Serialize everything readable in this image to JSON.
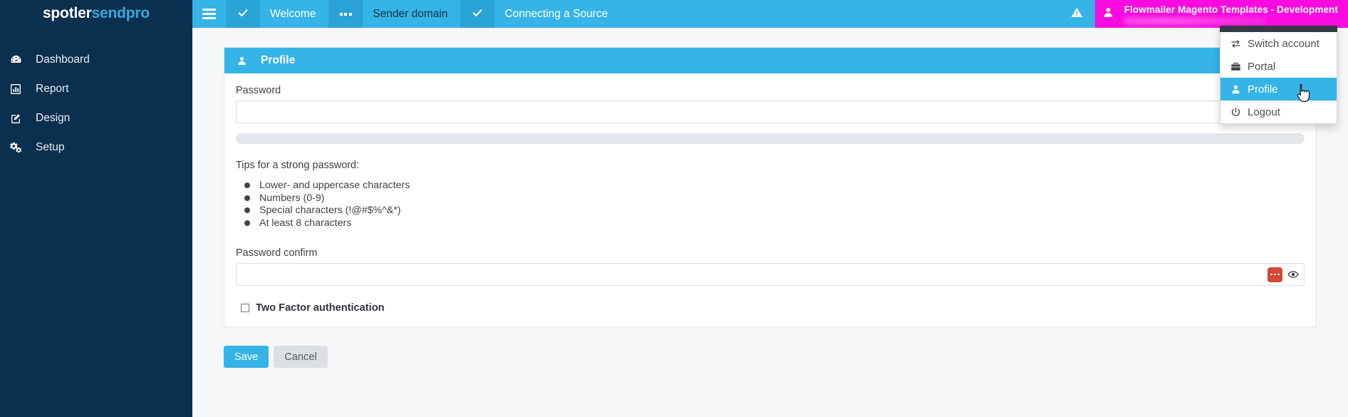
{
  "brand": {
    "part1": "spotler",
    "part2": "sendpro"
  },
  "sidebar": {
    "items": [
      {
        "label": "Dashboard",
        "icon": "dashboard-icon"
      },
      {
        "label": "Report",
        "icon": "chart-bar-icon"
      },
      {
        "label": "Design",
        "icon": "pencil-square-icon"
      },
      {
        "label": "Setup",
        "icon": "gears-icon"
      }
    ]
  },
  "topbar": {
    "menu_toggle": "hamburger-icon",
    "steps": [
      {
        "status_icon": "check-icon",
        "label": "Welcome"
      },
      {
        "status_icon": "ellipsis-icon",
        "label": "Sender domain"
      },
      {
        "status_icon": "check-icon",
        "label": "Connecting a Source"
      }
    ],
    "warning_icon": "warning-triangle-icon",
    "account": {
      "icon": "user-icon",
      "name": "Flowmailer Magento Templates - Development",
      "subtitle_redacted": ""
    }
  },
  "account_menu": {
    "items": [
      {
        "label": "Switch account",
        "icon": "exchange-icon",
        "active": false
      },
      {
        "label": "Portal",
        "icon": "briefcase-icon",
        "active": false
      },
      {
        "label": "Profile",
        "icon": "user-icon",
        "active": true
      },
      {
        "label": "Logout",
        "icon": "power-icon",
        "active": false
      }
    ]
  },
  "profile_panel": {
    "icon": "user-icon",
    "title": "Profile",
    "password": {
      "label": "Password",
      "value": "",
      "placeholder": "",
      "strength_percent": 0
    },
    "tips": {
      "title": "Tips for a strong password:",
      "items": [
        "Lower- and uppercase characters",
        "Numbers (0-9)",
        "Special characters (!@#$%^&*)",
        "At least 8 characters"
      ]
    },
    "password_confirm": {
      "label": "Password confirm",
      "value": "",
      "placeholder": "",
      "manager_icon": "lastpass-dots-icon",
      "reveal_icon": "eye-icon"
    },
    "two_factor": {
      "label": "Two Factor authentication",
      "checked": false
    }
  },
  "actions": {
    "save_label": "Save",
    "cancel_label": "Cancel"
  },
  "colors": {
    "sidebar_bg": "#0b2f4e",
    "accent_blue": "#35b4e8",
    "accent_blue_dark": "#2aa3d6",
    "account_magenta": "#f90be0",
    "menu_cap": "#353b45",
    "page_bg": "#f6f7f9"
  }
}
